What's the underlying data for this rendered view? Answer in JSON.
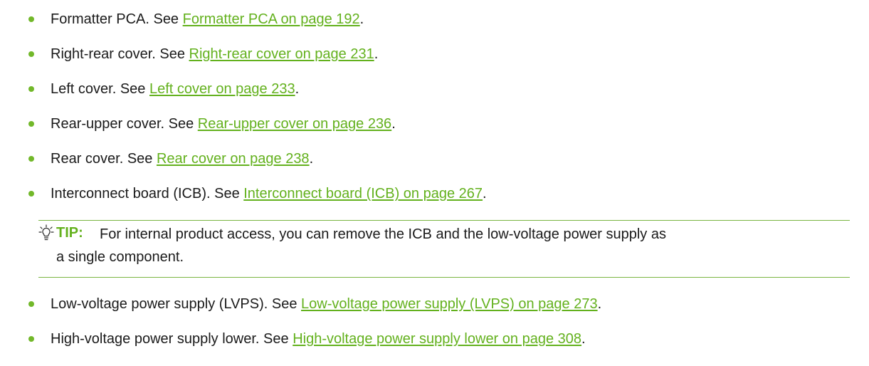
{
  "items_top": [
    {
      "text": "Formatter PCA. See ",
      "link": "Formatter PCA on page 192",
      "after": "."
    },
    {
      "text": "Right-rear cover. See ",
      "link": "Right-rear cover on page 231",
      "after": "."
    },
    {
      "text": "Left cover. See ",
      "link": "Left cover on page 233",
      "after": "."
    },
    {
      "text": "Rear-upper cover. See ",
      "link": "Rear-upper cover on page 236",
      "after": "."
    },
    {
      "text": "Rear cover. See ",
      "link": "Rear cover on page 238",
      "after": "."
    },
    {
      "text": "Interconnect board (ICB). See ",
      "link": "Interconnect board (ICB) on page 267",
      "after": "."
    }
  ],
  "tip": {
    "icon": "lightbulb-icon",
    "label": "TIP:",
    "line1": "For internal product access, you can remove the ICB and the low-voltage power supply as",
    "line2": "a single component."
  },
  "items_bottom": [
    {
      "text": "Low-voltage power supply (LVPS). See ",
      "link": "Low-voltage power supply (LVPS) on page 273",
      "after": "."
    },
    {
      "text": "High-voltage power supply lower. See ",
      "link": "High-voltage power supply lower on page 308",
      "after": "."
    }
  ],
  "colors": {
    "accent": "#63b11d",
    "bullet": "#72b82a",
    "rule": "#7ab541",
    "text": "#1a1a1a"
  }
}
